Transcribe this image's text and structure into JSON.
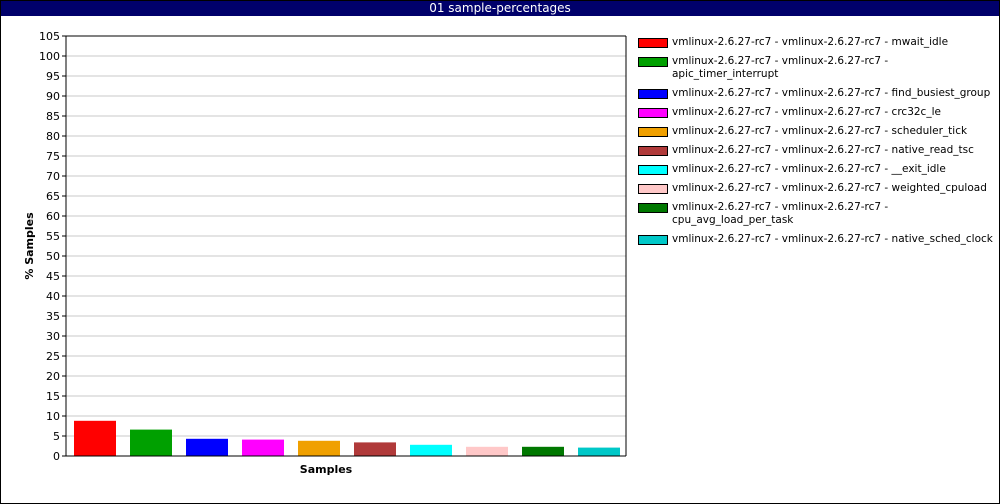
{
  "window": {
    "title": "01 sample-percentages"
  },
  "chart_data": {
    "type": "bar",
    "title": "01 sample-percentages",
    "xlabel": "Samples",
    "ylabel": "% Samples",
    "ylim": [
      0,
      105
    ],
    "ytick_step": 5,
    "grid": true,
    "legend_position": "right",
    "series": [
      {
        "name": "vmlinux-2.6.27-rc7 - vmlinux-2.6.27-rc7 - mwait_idle",
        "value": 8.8,
        "color": "#ff0000"
      },
      {
        "name": "vmlinux-2.6.27-rc7 - vmlinux-2.6.27-rc7 - apic_timer_interrupt",
        "value": 6.6,
        "color": "#00a000"
      },
      {
        "name": "vmlinux-2.6.27-rc7 - vmlinux-2.6.27-rc7 - find_busiest_group",
        "value": 4.3,
        "color": "#0000ff"
      },
      {
        "name": "vmlinux-2.6.27-rc7 - vmlinux-2.6.27-rc7 - crc32c_le",
        "value": 4.1,
        "color": "#ff00ff"
      },
      {
        "name": "vmlinux-2.6.27-rc7 - vmlinux-2.6.27-rc7 - scheduler_tick",
        "value": 3.8,
        "color": "#f0a000"
      },
      {
        "name": "vmlinux-2.6.27-rc7 - vmlinux-2.6.27-rc7 - native_read_tsc",
        "value": 3.4,
        "color": "#b03a3a"
      },
      {
        "name": "vmlinux-2.6.27-rc7 - vmlinux-2.6.27-rc7 - __exit_idle",
        "value": 2.8,
        "color": "#00ffff"
      },
      {
        "name": "vmlinux-2.6.27-rc7 - vmlinux-2.6.27-rc7 - weighted_cpuload",
        "value": 2.3,
        "color": "#ffc8c8"
      },
      {
        "name": "vmlinux-2.6.27-rc7 - vmlinux-2.6.27-rc7 - cpu_avg_load_per_task",
        "value": 2.3,
        "color": "#007800"
      },
      {
        "name": "vmlinux-2.6.27-rc7 - vmlinux-2.6.27-rc7 - native_sched_clock",
        "value": 2.1,
        "color": "#00c8c8"
      }
    ]
  }
}
